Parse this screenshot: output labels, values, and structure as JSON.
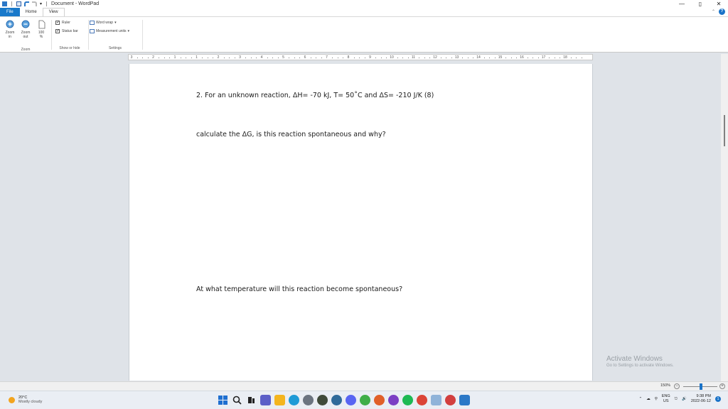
{
  "window": {
    "title": "Document - WordPad",
    "controls": {
      "minimize": "—",
      "maximize": "▯",
      "close": "✕"
    }
  },
  "ribbon": {
    "tabs": [
      "File",
      "Home",
      "View"
    ],
    "zoom_group": {
      "zoom_in": [
        "Zoom",
        "in"
      ],
      "zoom_out": [
        "Zoom",
        "out"
      ],
      "hundred": [
        "100",
        "%"
      ],
      "label": "Zoom"
    },
    "show_hide": {
      "ruler": "Ruler",
      "status_bar": "Status bar",
      "label": "Show or hide"
    },
    "settings": {
      "word_wrap": "Word wrap",
      "measurement_units": "Measurement units",
      "label": "Settings"
    }
  },
  "ruler": {
    "numbers": [
      "3",
      "2",
      "1",
      "1",
      "2",
      "3",
      "4",
      "5",
      "6",
      "7",
      "8",
      "9",
      "10",
      "11",
      "12",
      "13",
      "14",
      "15",
      "16",
      "17",
      "18"
    ]
  },
  "document": {
    "line1": "2. For an unknown reaction, ΔH= -70 kJ, T= 50˚C and ΔS= -210 J/K (8)",
    "line2": "calculate the ΔG, is this reaction spontaneous and why?",
    "line3": "At what temperature will this reaction become spontaneous?"
  },
  "watermark": {
    "title": "Activate Windows",
    "subtitle": "Go to Settings to activate Windows."
  },
  "statusbar": {
    "zoom": "150%",
    "zoom_level": 0.5
  },
  "taskbar": {
    "weather": {
      "temp": "20°C",
      "condition": "Mostly cloudy"
    },
    "language": [
      "ENG",
      "US"
    ],
    "time": "9:38 PM",
    "date": "2022-06-12",
    "notification_count": "1",
    "apps": [
      {
        "name": "windows-start-icon",
        "color": "#1f6fd0"
      },
      {
        "name": "search-icon",
        "color": "#2a2a2a"
      },
      {
        "name": "task-view-icon",
        "color": "#2a2a2a"
      },
      {
        "name": "chat-icon",
        "color": "#5b5fc7"
      },
      {
        "name": "file-explorer-icon",
        "color": "#f4b51f"
      },
      {
        "name": "edge-icon",
        "color": "#1e9ad6"
      },
      {
        "name": "app-icon-1",
        "color": "#6b7480"
      },
      {
        "name": "app-icon-2",
        "color": "#3f4a3a"
      },
      {
        "name": "app-icon-3",
        "color": "#2f6a9a"
      },
      {
        "name": "discord-icon",
        "color": "#5865f2"
      },
      {
        "name": "app-icon-4",
        "color": "#3fae49"
      },
      {
        "name": "app-icon-5",
        "color": "#e0602a"
      },
      {
        "name": "app-icon-6",
        "color": "#7b3fc4"
      },
      {
        "name": "spotify-icon",
        "color": "#1db954"
      },
      {
        "name": "chrome-icon",
        "color": "#db4437"
      },
      {
        "name": "photos-icon",
        "color": "#8fb3d9"
      },
      {
        "name": "app-icon-7",
        "color": "#d23f3f"
      },
      {
        "name": "wordpad-icon",
        "color": "#2b78c7"
      }
    ]
  }
}
